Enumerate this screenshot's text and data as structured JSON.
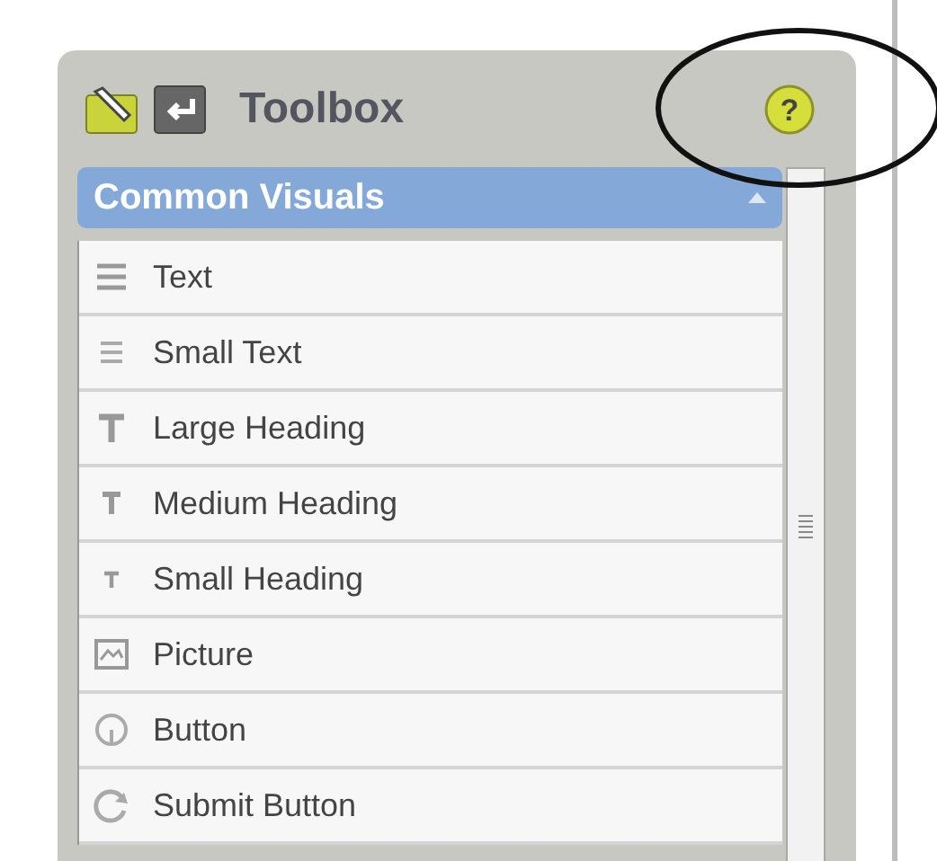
{
  "panel": {
    "title": "Toolbox",
    "help": "?"
  },
  "section": {
    "title": "Common Visuals",
    "expanded": true
  },
  "items": [
    {
      "label": "Text",
      "kind": "text"
    },
    {
      "label": "Small Text",
      "kind": "small-text"
    },
    {
      "label": "Large Heading",
      "kind": "large-heading"
    },
    {
      "label": "Medium Heading",
      "kind": "medium-heading"
    },
    {
      "label": "Small Heading",
      "kind": "small-heading"
    },
    {
      "label": "Picture",
      "kind": "picture"
    },
    {
      "label": "Button",
      "kind": "button"
    },
    {
      "label": "Submit Button",
      "kind": "submit"
    }
  ]
}
